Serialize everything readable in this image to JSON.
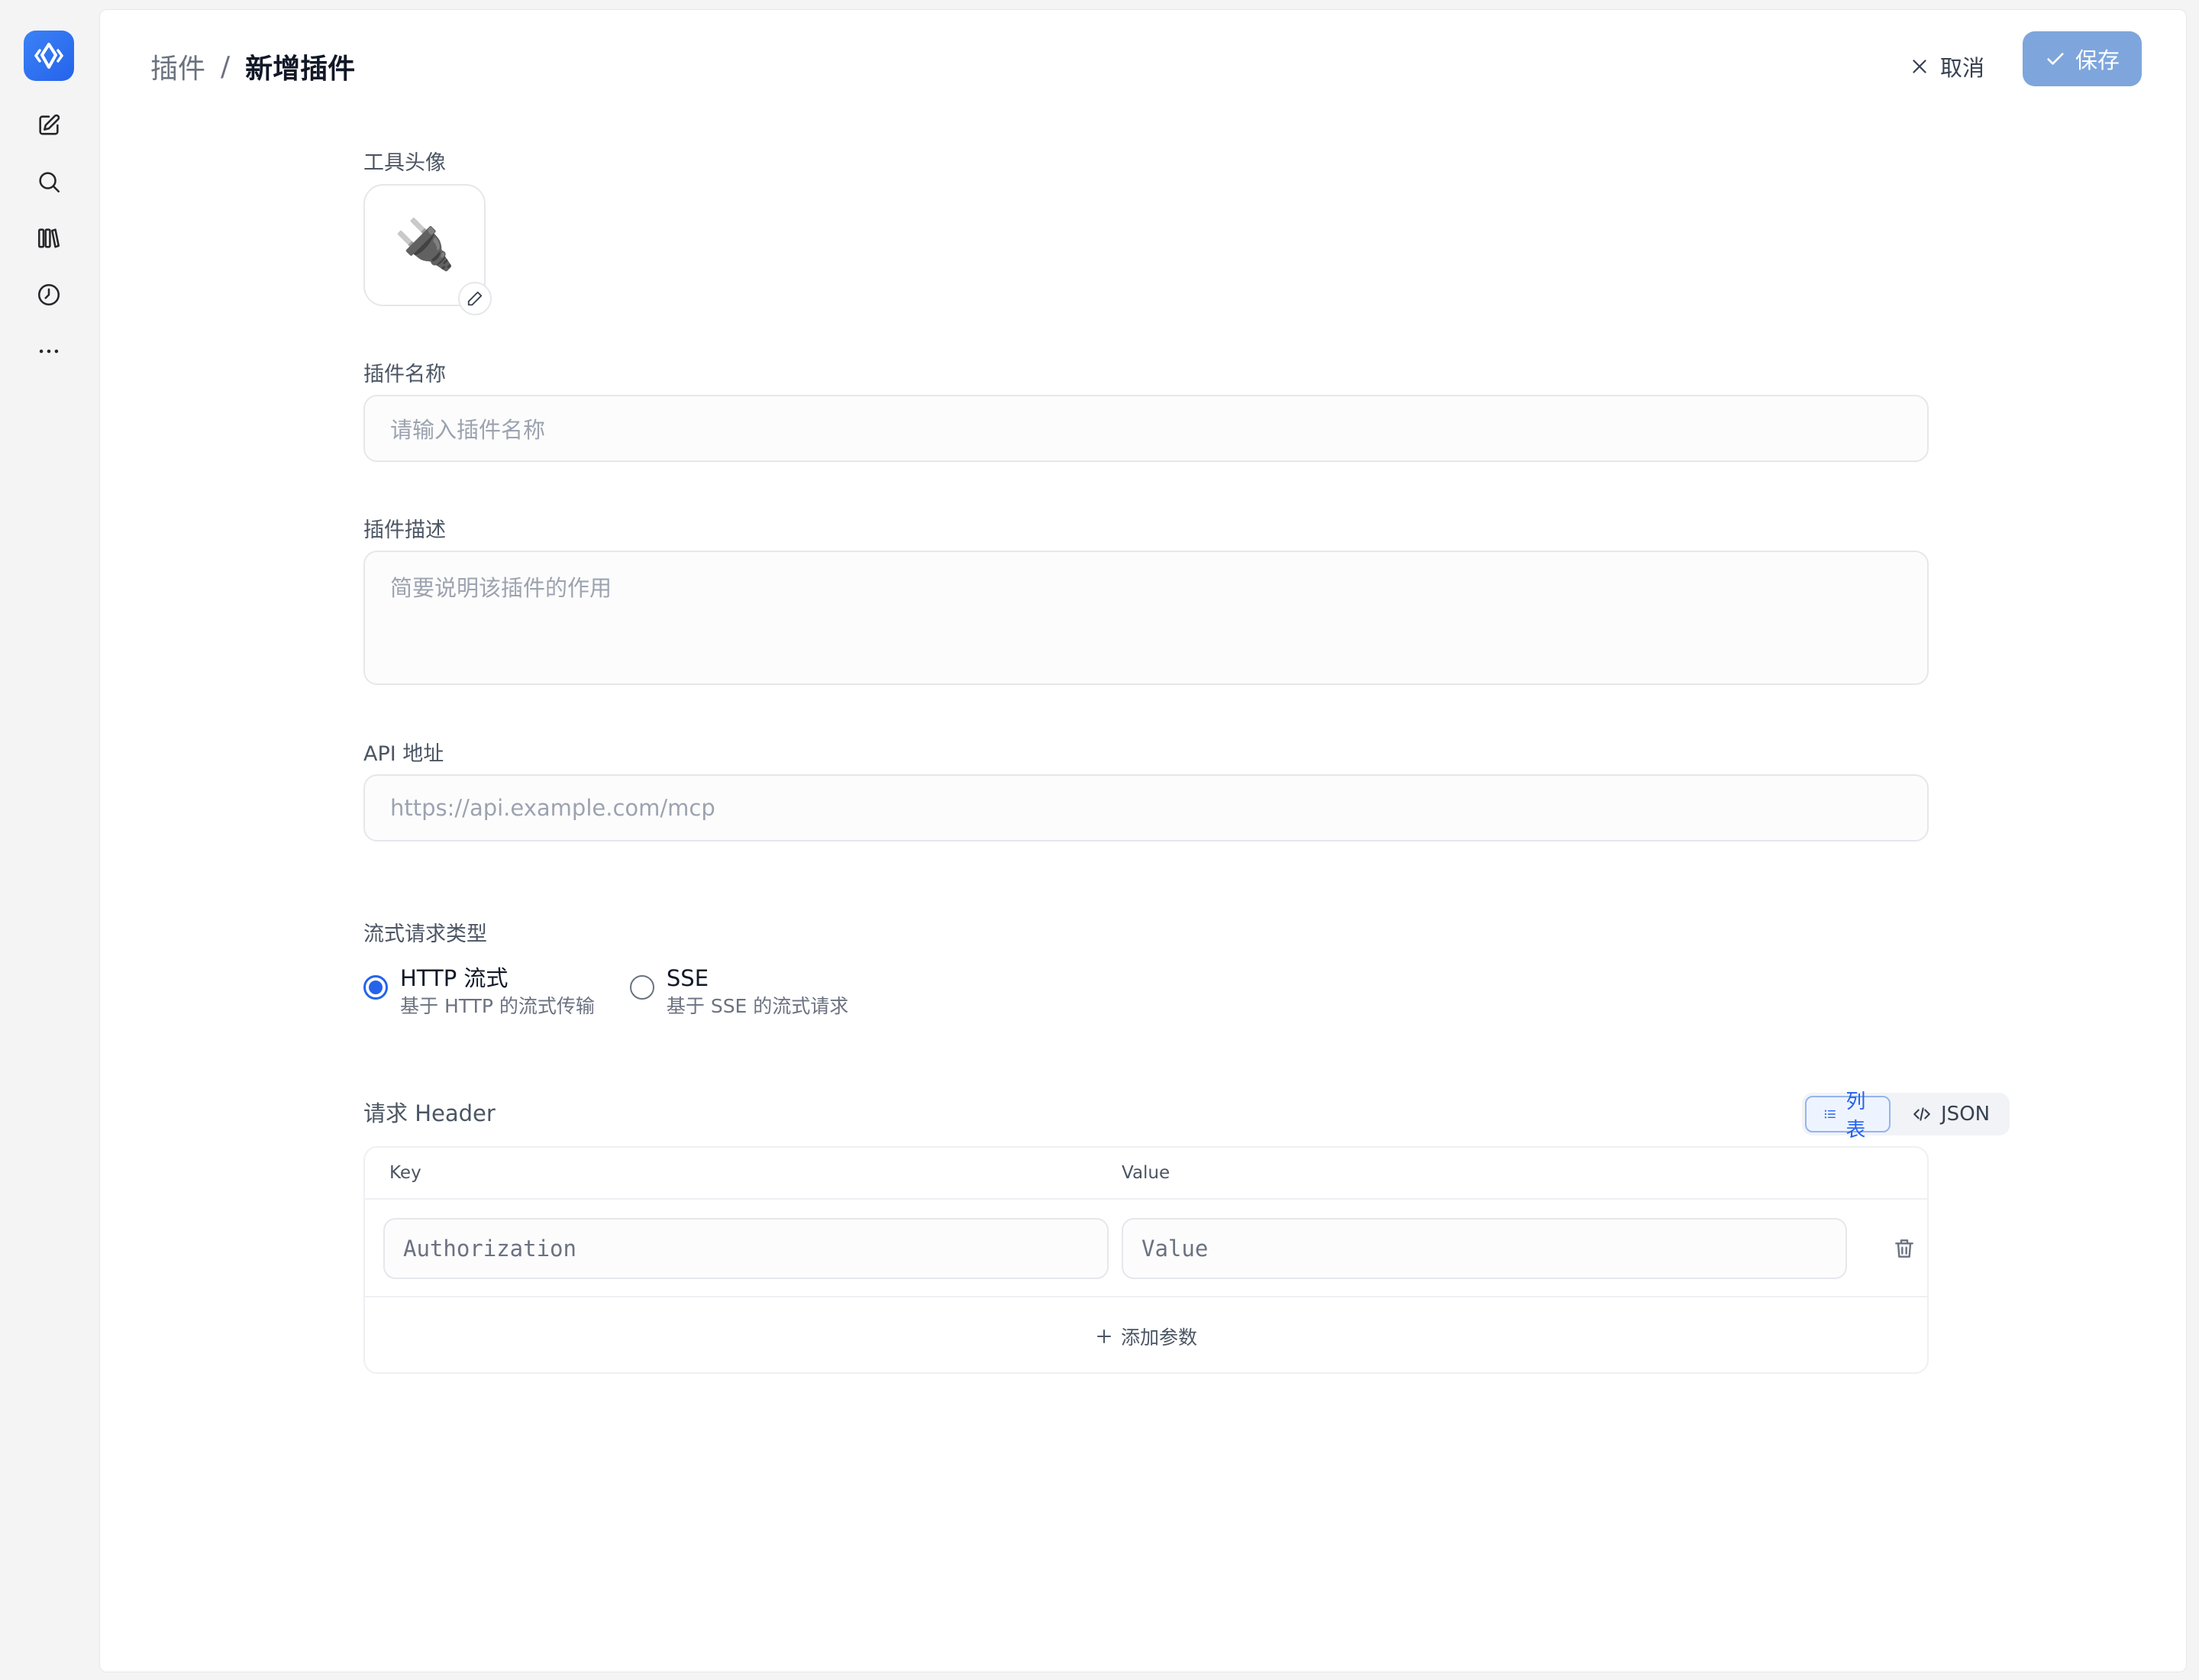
{
  "breadcrumb": {
    "parent": "插件",
    "separator": "/",
    "current": "新增插件"
  },
  "actions": {
    "cancel": "取消",
    "save": "保存"
  },
  "sidebar": {
    "items": [
      "compose-icon",
      "search-icon",
      "library-icon",
      "history-icon",
      "more-icon"
    ]
  },
  "form": {
    "avatar": {
      "label": "工具头像",
      "emoji": "🔌"
    },
    "name": {
      "label": "插件名称",
      "placeholder": "请输入插件名称"
    },
    "description": {
      "label": "插件描述",
      "placeholder": "简要说明该插件的作用"
    },
    "api": {
      "label": "API 地址",
      "placeholder": "https://api.example.com/mcp"
    },
    "stream": {
      "label": "流式请求类型",
      "options": [
        {
          "title": "HTTP 流式",
          "desc": "基于 HTTP 的流式传输",
          "selected": true
        },
        {
          "title": "SSE",
          "desc": "基于 SSE 的流式请求",
          "selected": false
        }
      ]
    },
    "headers": {
      "label": "请求 Header",
      "view_toggle": {
        "list": "列表",
        "json": "JSON",
        "active": "list"
      },
      "columns": {
        "key": "Key",
        "value": "Value"
      },
      "rows": [
        {
          "key_placeholder": "Authorization",
          "value_placeholder": "Value"
        }
      ],
      "add_label": "添加参数"
    }
  },
  "colors": {
    "accent": "#2563eb",
    "save_button": "#7ea6dc"
  }
}
